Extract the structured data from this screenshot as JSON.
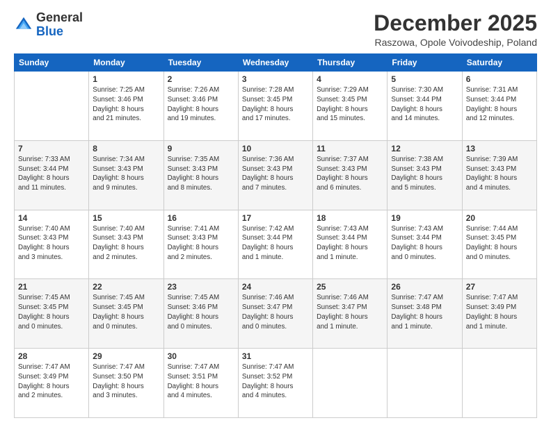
{
  "logo": {
    "general": "General",
    "blue": "Blue"
  },
  "title": "December 2025",
  "subtitle": "Raszowa, Opole Voivodeship, Poland",
  "days_of_week": [
    "Sunday",
    "Monday",
    "Tuesday",
    "Wednesday",
    "Thursday",
    "Friday",
    "Saturday"
  ],
  "weeks": [
    [
      {
        "day": "",
        "info": ""
      },
      {
        "day": "1",
        "info": "Sunrise: 7:25 AM\nSunset: 3:46 PM\nDaylight: 8 hours\nand 21 minutes."
      },
      {
        "day": "2",
        "info": "Sunrise: 7:26 AM\nSunset: 3:46 PM\nDaylight: 8 hours\nand 19 minutes."
      },
      {
        "day": "3",
        "info": "Sunrise: 7:28 AM\nSunset: 3:45 PM\nDaylight: 8 hours\nand 17 minutes."
      },
      {
        "day": "4",
        "info": "Sunrise: 7:29 AM\nSunset: 3:45 PM\nDaylight: 8 hours\nand 15 minutes."
      },
      {
        "day": "5",
        "info": "Sunrise: 7:30 AM\nSunset: 3:44 PM\nDaylight: 8 hours\nand 14 minutes."
      },
      {
        "day": "6",
        "info": "Sunrise: 7:31 AM\nSunset: 3:44 PM\nDaylight: 8 hours\nand 12 minutes."
      }
    ],
    [
      {
        "day": "7",
        "info": "Sunrise: 7:33 AM\nSunset: 3:44 PM\nDaylight: 8 hours\nand 11 minutes."
      },
      {
        "day": "8",
        "info": "Sunrise: 7:34 AM\nSunset: 3:43 PM\nDaylight: 8 hours\nand 9 minutes."
      },
      {
        "day": "9",
        "info": "Sunrise: 7:35 AM\nSunset: 3:43 PM\nDaylight: 8 hours\nand 8 minutes."
      },
      {
        "day": "10",
        "info": "Sunrise: 7:36 AM\nSunset: 3:43 PM\nDaylight: 8 hours\nand 7 minutes."
      },
      {
        "day": "11",
        "info": "Sunrise: 7:37 AM\nSunset: 3:43 PM\nDaylight: 8 hours\nand 6 minutes."
      },
      {
        "day": "12",
        "info": "Sunrise: 7:38 AM\nSunset: 3:43 PM\nDaylight: 8 hours\nand 5 minutes."
      },
      {
        "day": "13",
        "info": "Sunrise: 7:39 AM\nSunset: 3:43 PM\nDaylight: 8 hours\nand 4 minutes."
      }
    ],
    [
      {
        "day": "14",
        "info": "Sunrise: 7:40 AM\nSunset: 3:43 PM\nDaylight: 8 hours\nand 3 minutes."
      },
      {
        "day": "15",
        "info": "Sunrise: 7:40 AM\nSunset: 3:43 PM\nDaylight: 8 hours\nand 2 minutes."
      },
      {
        "day": "16",
        "info": "Sunrise: 7:41 AM\nSunset: 3:43 PM\nDaylight: 8 hours\nand 2 minutes."
      },
      {
        "day": "17",
        "info": "Sunrise: 7:42 AM\nSunset: 3:44 PM\nDaylight: 8 hours\nand 1 minute."
      },
      {
        "day": "18",
        "info": "Sunrise: 7:43 AM\nSunset: 3:44 PM\nDaylight: 8 hours\nand 1 minute."
      },
      {
        "day": "19",
        "info": "Sunrise: 7:43 AM\nSunset: 3:44 PM\nDaylight: 8 hours\nand 0 minutes."
      },
      {
        "day": "20",
        "info": "Sunrise: 7:44 AM\nSunset: 3:45 PM\nDaylight: 8 hours\nand 0 minutes."
      }
    ],
    [
      {
        "day": "21",
        "info": "Sunrise: 7:45 AM\nSunset: 3:45 PM\nDaylight: 8 hours\nand 0 minutes."
      },
      {
        "day": "22",
        "info": "Sunrise: 7:45 AM\nSunset: 3:45 PM\nDaylight: 8 hours\nand 0 minutes."
      },
      {
        "day": "23",
        "info": "Sunrise: 7:45 AM\nSunset: 3:46 PM\nDaylight: 8 hours\nand 0 minutes."
      },
      {
        "day": "24",
        "info": "Sunrise: 7:46 AM\nSunset: 3:47 PM\nDaylight: 8 hours\nand 0 minutes."
      },
      {
        "day": "25",
        "info": "Sunrise: 7:46 AM\nSunset: 3:47 PM\nDaylight: 8 hours\nand 1 minute."
      },
      {
        "day": "26",
        "info": "Sunrise: 7:47 AM\nSunset: 3:48 PM\nDaylight: 8 hours\nand 1 minute."
      },
      {
        "day": "27",
        "info": "Sunrise: 7:47 AM\nSunset: 3:49 PM\nDaylight: 8 hours\nand 1 minute."
      }
    ],
    [
      {
        "day": "28",
        "info": "Sunrise: 7:47 AM\nSunset: 3:49 PM\nDaylight: 8 hours\nand 2 minutes."
      },
      {
        "day": "29",
        "info": "Sunrise: 7:47 AM\nSunset: 3:50 PM\nDaylight: 8 hours\nand 3 minutes."
      },
      {
        "day": "30",
        "info": "Sunrise: 7:47 AM\nSunset: 3:51 PM\nDaylight: 8 hours\nand 4 minutes."
      },
      {
        "day": "31",
        "info": "Sunrise: 7:47 AM\nSunset: 3:52 PM\nDaylight: 8 hours\nand 4 minutes."
      },
      {
        "day": "",
        "info": ""
      },
      {
        "day": "",
        "info": ""
      },
      {
        "day": "",
        "info": ""
      }
    ]
  ]
}
